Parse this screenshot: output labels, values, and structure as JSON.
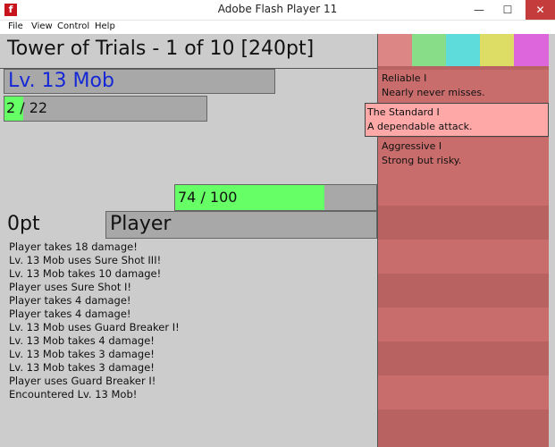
{
  "window": {
    "title": "Adobe Flash Player 11",
    "app_icon": "f",
    "minimize": "—",
    "maximize": "☐",
    "close": "✕"
  },
  "menu": [
    "File",
    "View",
    "Control",
    "Help"
  ],
  "game": {
    "title": "Tower of Trials - 1 of 10 [240pt]",
    "enemy": {
      "name": "Lv. 13 Mob",
      "name_color": "#1528d6",
      "hp_text": "2 / 22",
      "hp_current": 2,
      "hp_max": 22
    },
    "player": {
      "name": "Player",
      "score": "0pt",
      "hp_text": "74 / 100",
      "hp_current": 74,
      "hp_max": 100
    },
    "log": [
      "Player takes 18 damage!",
      "Lv. 13 Mob uses Sure Shot III!",
      "Lv. 13 Mob takes 10 damage!",
      "Player uses Sure Shot I!",
      "Player takes 4 damage!",
      "Player takes 4 damage!",
      "Lv. 13 Mob uses Guard Breaker I!",
      "Lv. 13 Mob takes 4 damage!",
      "Lv. 13 Mob takes 3 damage!",
      "Lv. 13 Mob takes 3 damage!",
      "Player uses Guard Breaker I!",
      "Encountered Lv. 13 Mob!"
    ],
    "colors": {
      "stage": "#cccccc",
      "hp_fill": "#66ff66",
      "stripe_a": "#c96c6c",
      "stripe_b": "#b96262",
      "card_selected": "#ffa8a8"
    },
    "palette": [
      "#dd8686",
      "#88dd88",
      "#5edcdc",
      "#dddd66",
      "#dd66dd"
    ],
    "skills": [
      {
        "name": "Reliable I",
        "desc": "Nearly never misses."
      },
      {
        "name": "The Standard I",
        "desc": "A dependable attack.",
        "selected": true
      },
      {
        "name": "Aggressive I",
        "desc": "Strong but risky."
      }
    ]
  }
}
